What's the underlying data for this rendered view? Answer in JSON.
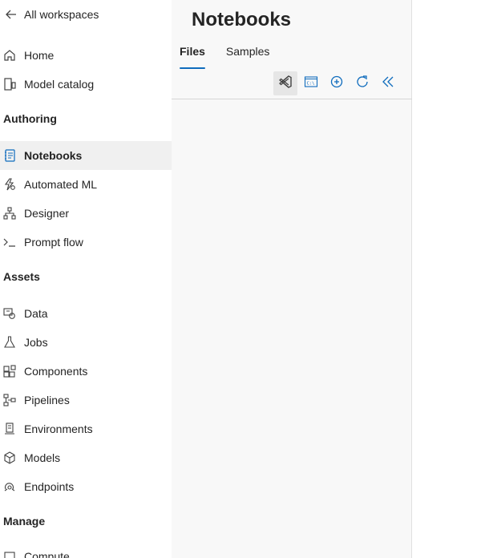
{
  "sidebar": {
    "back_label": "All workspaces",
    "top_items": [
      {
        "label": "Home",
        "icon": "home-icon"
      },
      {
        "label": "Model catalog",
        "icon": "model-catalog-icon"
      }
    ],
    "sections": [
      {
        "title": "Authoring",
        "items": [
          {
            "label": "Notebooks",
            "icon": "notebook-icon",
            "active": true
          },
          {
            "label": "Automated ML",
            "icon": "automated-ml-icon"
          },
          {
            "label": "Designer",
            "icon": "designer-icon"
          },
          {
            "label": "Prompt flow",
            "icon": "prompt-flow-icon"
          }
        ]
      },
      {
        "title": "Assets",
        "items": [
          {
            "label": "Data",
            "icon": "data-icon"
          },
          {
            "label": "Jobs",
            "icon": "jobs-flask-icon"
          },
          {
            "label": "Components",
            "icon": "components-icon"
          },
          {
            "label": "Pipelines",
            "icon": "pipelines-icon"
          },
          {
            "label": "Environments",
            "icon": "environments-icon"
          },
          {
            "label": "Models",
            "icon": "models-cube-icon"
          },
          {
            "label": "Endpoints",
            "icon": "endpoints-icon"
          }
        ]
      },
      {
        "title": "Manage",
        "items": [
          {
            "label": "Compute",
            "icon": "compute-icon"
          }
        ]
      }
    ]
  },
  "panel": {
    "title": "Notebooks",
    "tabs": [
      {
        "label": "Files",
        "selected": true
      },
      {
        "label": "Samples",
        "selected": false
      }
    ],
    "toolbar": [
      {
        "icon": "vscode-icon"
      },
      {
        "icon": "terminal-icon"
      },
      {
        "icon": "add-circle-icon"
      },
      {
        "icon": "refresh-icon"
      },
      {
        "icon": "collapse-double-chevron-icon"
      }
    ]
  },
  "colors": {
    "accent": "#0f6cbd",
    "panel_bg": "#f8f8f8",
    "active_bg": "#f0f0f0"
  }
}
